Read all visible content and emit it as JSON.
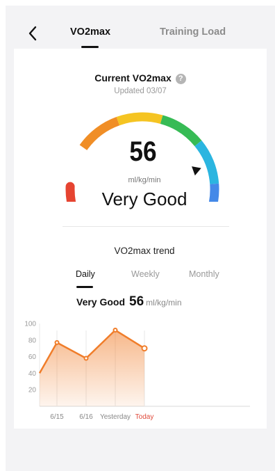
{
  "header": {
    "tabs": [
      {
        "label": "VO2max",
        "active": true
      },
      {
        "label": "Training Load",
        "active": false
      }
    ]
  },
  "current": {
    "title": "Current VO2max",
    "updated_label": "Updated",
    "updated_date": "03/07",
    "value": "56",
    "unit": "ml/kg/min",
    "level": "Very Good"
  },
  "gauge": {
    "segments": [
      "#e64431",
      "#f08e26",
      "#f5c422",
      "#37bb55",
      "#2bb5e0",
      "#4489e8",
      "#e1e3f5"
    ],
    "marker_segment": 5
  },
  "trend": {
    "title": "VO2max trend",
    "periods": [
      "Daily",
      "Weekly",
      "Monthly"
    ],
    "active_period": "Daily",
    "summary_level": "Very Good",
    "summary_value": "56",
    "summary_unit": "ml/kg/min"
  },
  "colors": {
    "accent": "#f07d2a",
    "today": "#e04b3c"
  },
  "chart_data": {
    "type": "area",
    "y_ticks": [
      20,
      40,
      60,
      80,
      100
    ],
    "ylim": [
      0,
      100
    ],
    "x_labels": [
      "6/15",
      "6/16",
      "Yesterday",
      "Today"
    ],
    "values": [
      40,
      77,
      58,
      92,
      70
    ],
    "highlight_label": "Today"
  }
}
